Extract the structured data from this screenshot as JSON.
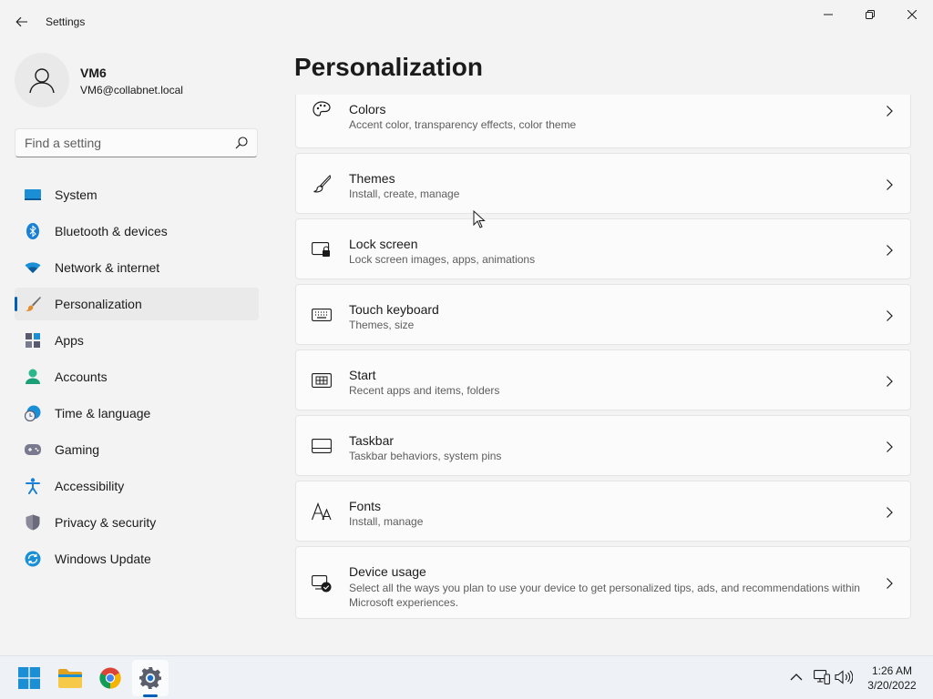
{
  "window": {
    "title": "Settings",
    "icons": {
      "back": "back-arrow-icon",
      "minimize": "minimize-icon",
      "maximize": "restore-icon",
      "close": "close-icon"
    }
  },
  "profile": {
    "name": "VM6",
    "email": "VM6@collabnet.local",
    "icon": "user-avatar-icon"
  },
  "search": {
    "placeholder": "Find a setting",
    "value": "",
    "icon": "search-icon"
  },
  "nav": {
    "selected": "Personalization",
    "items": [
      {
        "label": "System",
        "icon": "system-icon"
      },
      {
        "label": "Bluetooth & devices",
        "icon": "bluetooth-icon"
      },
      {
        "label": "Network & internet",
        "icon": "wifi-icon"
      },
      {
        "label": "Personalization",
        "icon": "brush-icon"
      },
      {
        "label": "Apps",
        "icon": "apps-icon"
      },
      {
        "label": "Accounts",
        "icon": "accounts-icon"
      },
      {
        "label": "Time & language",
        "icon": "globe-clock-icon"
      },
      {
        "label": "Gaming",
        "icon": "gamepad-icon"
      },
      {
        "label": "Accessibility",
        "icon": "accessibility-icon"
      },
      {
        "label": "Privacy & security",
        "icon": "shield-icon"
      },
      {
        "label": "Windows Update",
        "icon": "update-icon"
      }
    ]
  },
  "page": {
    "title": "Personalization",
    "cards": [
      {
        "title": "Colors",
        "subtitle": "Accent color, transparency effects, color theme",
        "icon": "palette-icon"
      },
      {
        "title": "Themes",
        "subtitle": "Install, create, manage",
        "icon": "brush-icon"
      },
      {
        "title": "Lock screen",
        "subtitle": "Lock screen images, apps, animations",
        "icon": "lock-screen-icon"
      },
      {
        "title": "Touch keyboard",
        "subtitle": "Themes, size",
        "icon": "keyboard-icon"
      },
      {
        "title": "Start",
        "subtitle": "Recent apps and items, folders",
        "icon": "start-icon"
      },
      {
        "title": "Taskbar",
        "subtitle": "Taskbar behaviors, system pins",
        "icon": "taskbar-icon"
      },
      {
        "title": "Fonts",
        "subtitle": "Install, manage",
        "icon": "fonts-icon"
      },
      {
        "title": "Device usage",
        "subtitle": "Select all the ways you plan to use your device to get personalized tips, ads, and recommendations within Microsoft experiences.",
        "icon": "device-usage-icon"
      }
    ]
  },
  "taskbar": {
    "apps": [
      {
        "name": "Start",
        "icon": "windows-start-icon"
      },
      {
        "name": "File Explorer",
        "icon": "folder-icon"
      },
      {
        "name": "Google Chrome",
        "icon": "chrome-icon"
      },
      {
        "name": "Settings",
        "icon": "settings-gear-icon"
      }
    ],
    "tray": {
      "time": "1:26 AM",
      "date": "3/20/2022",
      "icons": [
        "chevron-up-icon",
        "network-icon",
        "volume-icon"
      ]
    }
  },
  "colors": {
    "accent": "#005fb8",
    "background": "#f3f3f3",
    "card": "#fbfbfb"
  }
}
